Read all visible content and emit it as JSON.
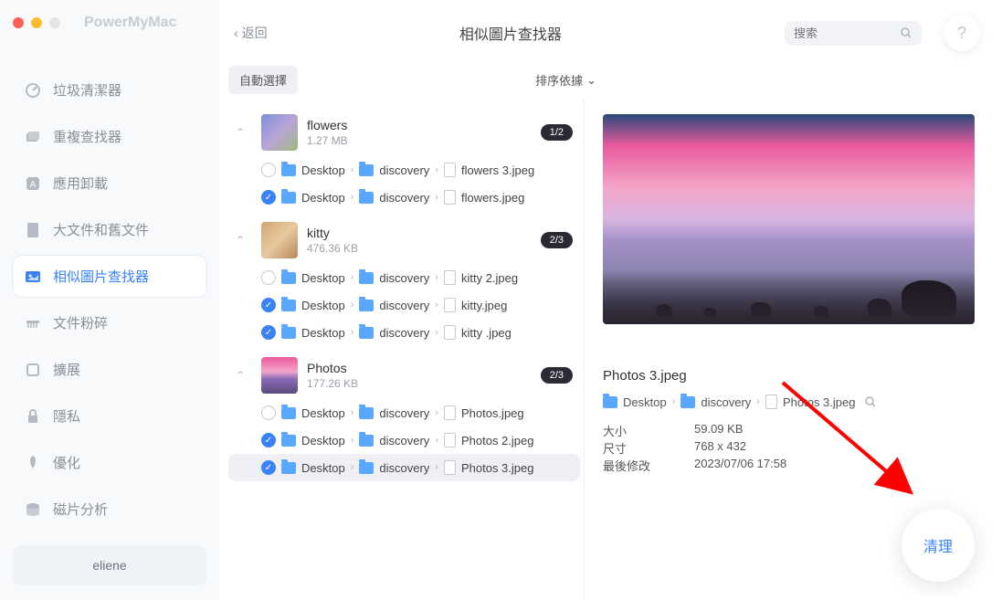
{
  "brand": "PowerMyMac",
  "back_label": "返回",
  "title": "相似圖片查找器",
  "search_placeholder": "搜索",
  "help_label": "?",
  "auto_select_label": "自動選擇",
  "sort_label": "排序依據",
  "sidebar": {
    "items": [
      {
        "label": "垃圾清潔器"
      },
      {
        "label": "重複查找器"
      },
      {
        "label": "應用卸載"
      },
      {
        "label": "大文件和舊文件"
      },
      {
        "label": "相似圖片查找器"
      },
      {
        "label": "文件粉碎"
      },
      {
        "label": "擴展"
      },
      {
        "label": "隱私"
      },
      {
        "label": "優化"
      },
      {
        "label": "磁片分析"
      }
    ],
    "user": "eliene"
  },
  "groups": [
    {
      "name": "flowers",
      "size": "1.27 MB",
      "badge": "1/2",
      "files": [
        {
          "checked": false,
          "path": [
            "Desktop",
            "discovery"
          ],
          "file": "flowers 3.jpeg"
        },
        {
          "checked": true,
          "path": [
            "Desktop",
            "discovery"
          ],
          "file": "flowers.jpeg"
        }
      ]
    },
    {
      "name": "kitty",
      "size": "476.36 KB",
      "badge": "2/3",
      "files": [
        {
          "checked": false,
          "path": [
            "Desktop",
            "discovery"
          ],
          "file": "kitty 2.jpeg"
        },
        {
          "checked": true,
          "path": [
            "Desktop",
            "discovery"
          ],
          "file": "kitty.jpeg"
        },
        {
          "checked": true,
          "path": [
            "Desktop",
            "discovery"
          ],
          "file": "kitty .jpeg"
        }
      ]
    },
    {
      "name": "Photos",
      "size": "177.26 KB",
      "badge": "2/3",
      "files": [
        {
          "checked": false,
          "path": [
            "Desktop",
            "discovery"
          ],
          "file": "Photos.jpeg"
        },
        {
          "checked": true,
          "path": [
            "Desktop",
            "discovery"
          ],
          "file": "Photos 2.jpeg"
        },
        {
          "checked": true,
          "path": [
            "Desktop",
            "discovery"
          ],
          "file": "Photos 3.jpeg",
          "selected": true
        }
      ]
    }
  ],
  "preview": {
    "filename": "Photos 3.jpeg",
    "path": [
      "Desktop",
      "discovery",
      "Photos 3.jpeg"
    ],
    "meta": {
      "size_label": "大小",
      "size_val": "59.09 KB",
      "dim_label": "尺寸",
      "dim_val": "768 x 432",
      "mod_label": "最後修改",
      "mod_val": "2023/07/06 17:58"
    }
  },
  "clean_label": "清理"
}
